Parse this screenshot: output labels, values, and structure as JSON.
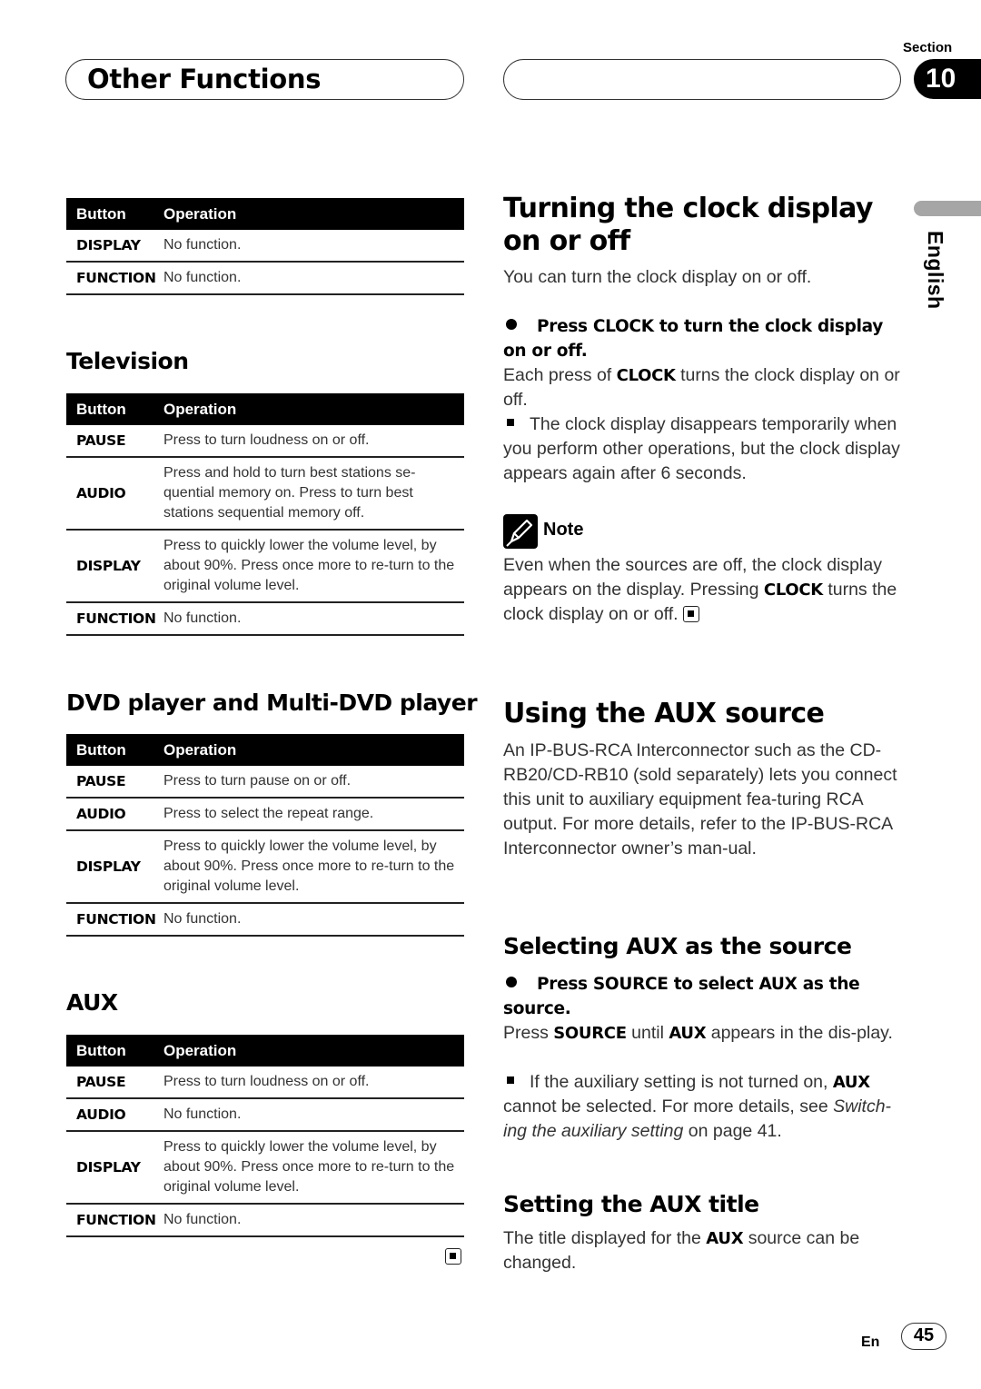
{
  "header": {
    "chapter_title": "Other Functions",
    "section_label": "Section",
    "section_number": "10"
  },
  "language_tab": "English",
  "left_column": {
    "table0": {
      "headers": [
        "Button",
        "Operation"
      ],
      "rows": [
        {
          "button": "DISPLAY",
          "operation": "No function."
        },
        {
          "button": "FUNCTION",
          "operation": "No function."
        }
      ]
    },
    "television": {
      "heading": "Television",
      "headers": [
        "Button",
        "Operation"
      ],
      "rows": [
        {
          "button": "PAUSE",
          "operation": "Press to turn loudness on or off."
        },
        {
          "button": "AUDIO",
          "operation": "Press and hold to turn best stations se-quential memory on. Press to turn best stations sequential memory off."
        },
        {
          "button": "DISPLAY",
          "operation": "Press to quickly lower the volume level, by about 90%. Press once more to re-turn to the original volume level."
        },
        {
          "button": "FUNCTION",
          "operation": "No function."
        }
      ]
    },
    "dvd": {
      "heading": "DVD player and Multi-DVD player",
      "headers": [
        "Button",
        "Operation"
      ],
      "rows": [
        {
          "button": "PAUSE",
          "operation": "Press to turn pause on or off."
        },
        {
          "button": "AUDIO",
          "operation": "Press to select the repeat range."
        },
        {
          "button": "DISPLAY",
          "operation": "Press to quickly lower the volume level, by about 90%. Press once more to re-turn to the original volume level."
        },
        {
          "button": "FUNCTION",
          "operation": "No function."
        }
      ]
    },
    "aux": {
      "heading": "AUX",
      "headers": [
        "Button",
        "Operation"
      ],
      "rows": [
        {
          "button": "PAUSE",
          "operation": "Press to turn loudness on or off."
        },
        {
          "button": "AUDIO",
          "operation": "No function."
        },
        {
          "button": "DISPLAY",
          "operation": "Press to quickly lower the volume level, by about 90%. Press once more to re-turn to the original volume level."
        },
        {
          "button": "FUNCTION",
          "operation": "No function."
        }
      ]
    }
  },
  "right_column": {
    "clock": {
      "heading": "Turning the clock display on or off",
      "intro": "You can turn the clock display on or off.",
      "step": "Press CLOCK to turn the clock display on or off.",
      "step_body_pre": "Each press of ",
      "step_body_bold": "CLOCK",
      "step_body_post": " turns the clock display on or off.",
      "bullet": "The clock display disappears temporarily when you perform other operations, but the clock display appears again after 6 seconds.",
      "note_label": "Note",
      "note_pre": "Even when the sources are off, the clock display appears on the display. Pressing ",
      "note_bold": "CLOCK",
      "note_post": " turns the clock display on or off."
    },
    "aux_source": {
      "heading": "Using the AUX source",
      "body": "An IP-BUS-RCA Interconnector such as the CD-RB20/CD-RB10 (sold separately) lets you connect this unit to auxiliary equipment fea-turing RCA output. For more details, refer to the IP-BUS-RCA Interconnector owner’s man-ual."
    },
    "selecting": {
      "heading": "Selecting AUX as the source",
      "step": "Press SOURCE to select AUX as the source.",
      "body_1": "Press ",
      "body_2": "SOURCE",
      "body_3": " until ",
      "body_4": "AUX",
      "body_5": " appears in the dis-play.",
      "bullet_1": "If the auxiliary setting is not turned on, ",
      "bullet_2": "AUX",
      "bullet_3": " cannot be selected. For more details, see ",
      "bullet_italic": "Switch-ing the auxiliary setting",
      "bullet_4": " on page 41."
    },
    "aux_title": {
      "heading": "Setting the AUX title",
      "body_1": "The title displayed for the ",
      "body_2": "AUX",
      "body_3": " source can be changed."
    }
  },
  "footer": {
    "lang_code": "En",
    "page_number": "45"
  }
}
